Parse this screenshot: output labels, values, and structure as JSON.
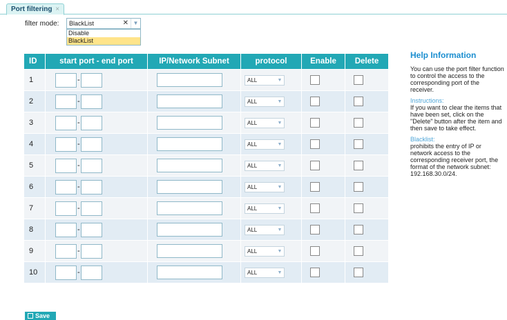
{
  "tab": {
    "label": "Port filtering",
    "close": "×"
  },
  "filter_mode": {
    "label": "filter mode:",
    "value": "BlackList",
    "clear": "✕",
    "options": [
      "Disable",
      "BlackList"
    ]
  },
  "table": {
    "headers": {
      "id": "ID",
      "ports": "start port - end port",
      "subnet": "IP/Network Subnet",
      "protocol": "protocol",
      "enable": "Enable",
      "delete": "Delete"
    },
    "dash": "-",
    "rows": [
      {
        "id": "1",
        "protocol": "ALL"
      },
      {
        "id": "2",
        "protocol": "ALL"
      },
      {
        "id": "3",
        "protocol": "ALL"
      },
      {
        "id": "4",
        "protocol": "ALL"
      },
      {
        "id": "5",
        "protocol": "ALL"
      },
      {
        "id": "6",
        "protocol": "ALL"
      },
      {
        "id": "7",
        "protocol": "ALL"
      },
      {
        "id": "8",
        "protocol": "ALL"
      },
      {
        "id": "9",
        "protocol": "ALL"
      },
      {
        "id": "10",
        "protocol": "ALL"
      }
    ]
  },
  "help": {
    "title": "Help Information",
    "intro": "You can use the port filter function to control the access to the corresponding port of the receiver.",
    "instructions_title": "Instructions:",
    "instructions": "If you want to clear the items that have been set, click on the \"Delete\" button after the item and then save to take effect.",
    "blacklist_title": "Blacklist:",
    "blacklist": "prohibits the entry of IP or network access to the corresponding receiver port, the format of the network subnet: 192.168.30.0/24."
  },
  "save_label": "Save",
  "colors": {
    "header": "#22a8b5",
    "help_title": "#1d8fd0",
    "row_odd": "#f1f4f7",
    "row_even": "#e2ecf4"
  }
}
